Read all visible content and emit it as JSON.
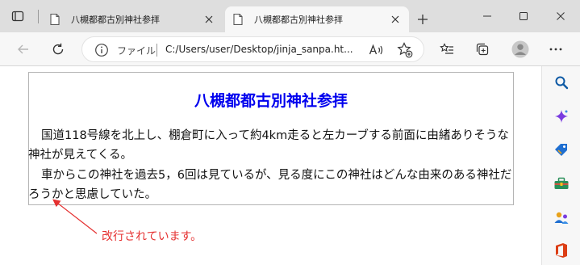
{
  "browser": {
    "tabs": [
      {
        "title": "八槻都都古別神社参拝",
        "active": false
      },
      {
        "title": "八槻都都古別神社参拝",
        "active": true
      }
    ],
    "address_bar": {
      "site_label": "ファイル",
      "url": "C:/Users/user/Desktop/jinja_sanpa.ht..."
    },
    "colors": {
      "accent_blue": "#0c59a4",
      "copilot_purple": "#7a3ce0"
    }
  },
  "page": {
    "heading": "八槻都都古別神社参拝",
    "paragraphs": [
      "国道118号線を北上し、棚倉町に入って約4km走ると左カーブする前面に由緒ありそうな神社が見えてくる。",
      "車からこの神社を過去5，6回は見ているが、見る度にこの神社はどんな由来のある神社だろうかと思慮していた。"
    ],
    "heading_color": "#0000ee",
    "annotation": {
      "text": "改行されています。",
      "color": "#e53030"
    }
  }
}
